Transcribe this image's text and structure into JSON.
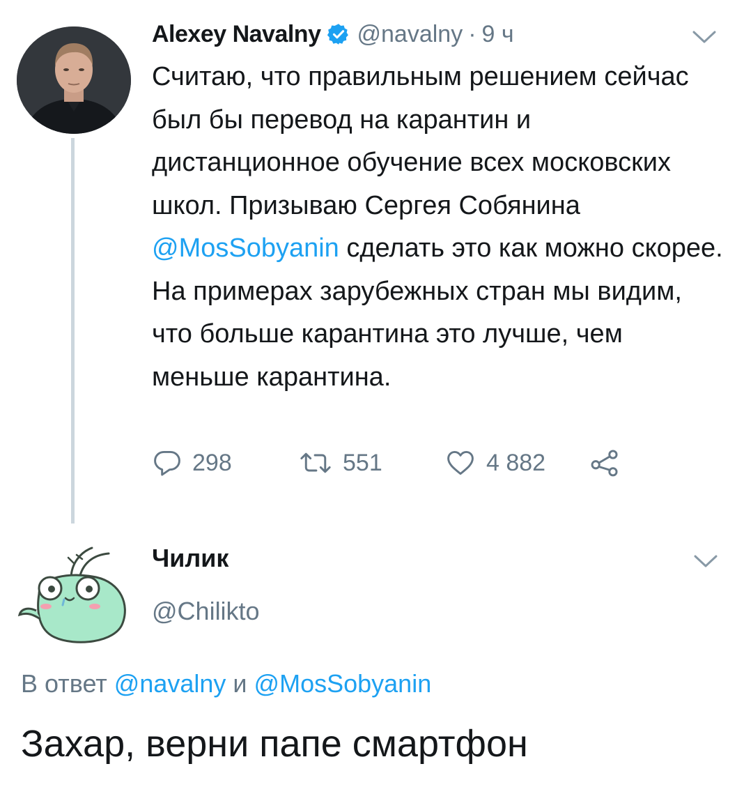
{
  "tweet": {
    "author_name": "Alexey Navalny",
    "author_handle": "@navalny",
    "separator": "·",
    "time": "9 ч",
    "text_part1": "Считаю, что правильным решением сейчас был бы перевод на карантин и дистанционное обучение всех московских школ. Призываю Сергея Собянина ",
    "text_mention": "@MosSobyanin",
    "text_part2": " сделать это как можно скорее. На примерах зарубежных стран мы видим, что больше карантина это лучше, чем меньше карантина.",
    "replies": "298",
    "retweets": "551",
    "likes": "4 882",
    "icons": {
      "verified": "verified-badge-icon",
      "menu": "chevron-down-icon",
      "reply": "reply-bubble-icon",
      "retweet": "retweet-icon",
      "like": "heart-icon",
      "share": "share-icon"
    }
  },
  "reply": {
    "author_name": "Чилик",
    "author_handle": "@Chilikto",
    "reply_to_prefix": "В ответ ",
    "reply_to_user1": "@navalny",
    "reply_to_conjunction": " и ",
    "reply_to_user2": "@MosSobyanin",
    "text": "Захар, верни папе смартфон"
  },
  "colors": {
    "text": "#14171a",
    "secondary": "#657786",
    "link": "#1da1f2",
    "thread_line": "#ccd6dd",
    "avatar2_fill": "#a8e8c9"
  }
}
